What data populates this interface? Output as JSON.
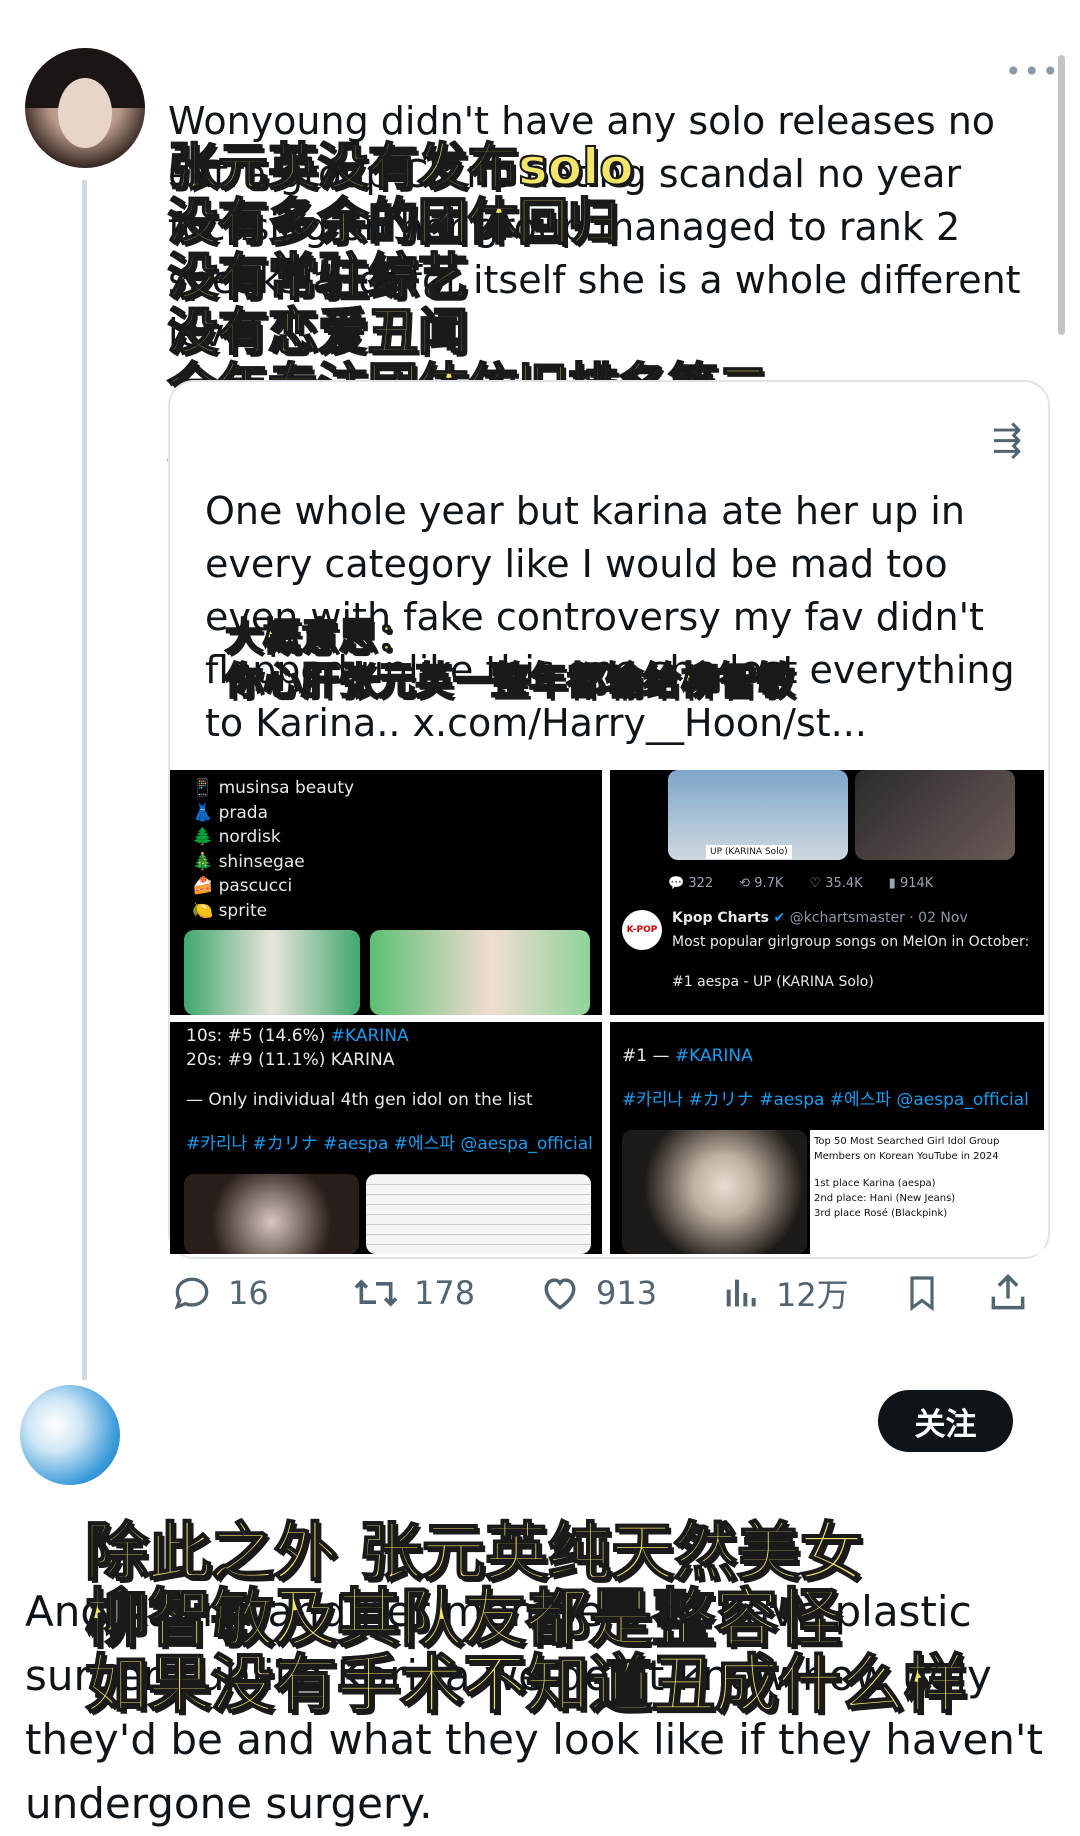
{
  "tweet": {
    "more_icon": "more-horizontal-icon",
    "text": "Wonyoung didn't have any solo releases no extra group CB no dating scandal no year focusing on her group managed to rank 2 speaks a lot for itself she is a whole different level .",
    "overlay_caption": "张元英没有发布solo\n没有多余的团体回归\n没有常驻综艺\n没有恋爱丑闻\n全年专注团体依旧排名第二\n她完全是不同的level",
    "quote": {
      "text": "One whole year but karina ate her up in every category like I would be mad too even with fake controversy my fav didn't flopped unlike this one she lost everything to Karina.. x.com/Harry__Hoon/st...",
      "overlay_caption": "大概意思：\n你心肝张元英一整年都输给柳智敏",
      "images": {
        "cell1_list": [
          "musinsa beauty",
          "prada",
          "nordisk",
          "shinsegae",
          "pascucci",
          "sprite"
        ],
        "cell2": {
          "stats": [
            "322",
            "9.7K",
            "35.4K",
            "914K"
          ],
          "account_name": "Kpop Charts",
          "account_handle": "@kchartsmaster · 02 Nov",
          "tweet_line": "Most popular girlgroup songs on MelOn in October:",
          "rank_line": "#1 aespa - UP (KARINA Solo)",
          "badge": "K-POP",
          "caption": "UP (KARINA Solo)"
        },
        "cell3": {
          "line1": "10s: #5 (14.6%) ",
          "line1_tag": "#KARINA",
          "line2": "20s: #9 (11.1%) KARINA",
          "line3": "— Only individual 4th gen idol on the list",
          "tags": "#카리나 #カリナ #aespa #에스파 @aespa_official"
        },
        "cell4": {
          "line1": "#1 — ",
          "line1_tag": "#KARINA",
          "tags": "#카리나 #カリナ #aespa #에스파 @aespa_official",
          "side_title": "Top 50 Most Searched Girl Idol Group Members on Korean YouTube in 2024",
          "side_1": "1st place Karina (aespa)",
          "side_2": "2nd place: Hani (New Jeans)",
          "side_3": "3rd place Rosé (Blackpink)"
        }
      }
    },
    "actions": {
      "replies": "16",
      "retweets": "178",
      "likes": "913",
      "views": "12万"
    }
  },
  "reply": {
    "follow_label": "关注",
    "text": "And Karina and her members all have plastic surgery unlike Karina we don't know how ugly they'd be and what they look like if they haven't undergone surgery.",
    "overlay_caption": "除此之外 张元英纯天然美女\n柳智敏及其队友都是整容怪\n如果没有手术不知道丑成什么样"
  },
  "colors": {
    "caption_yellow": "#f3e46a",
    "follow_bg": "#0f1419",
    "link_blue": "#1d9bf0",
    "muted": "#536471"
  }
}
